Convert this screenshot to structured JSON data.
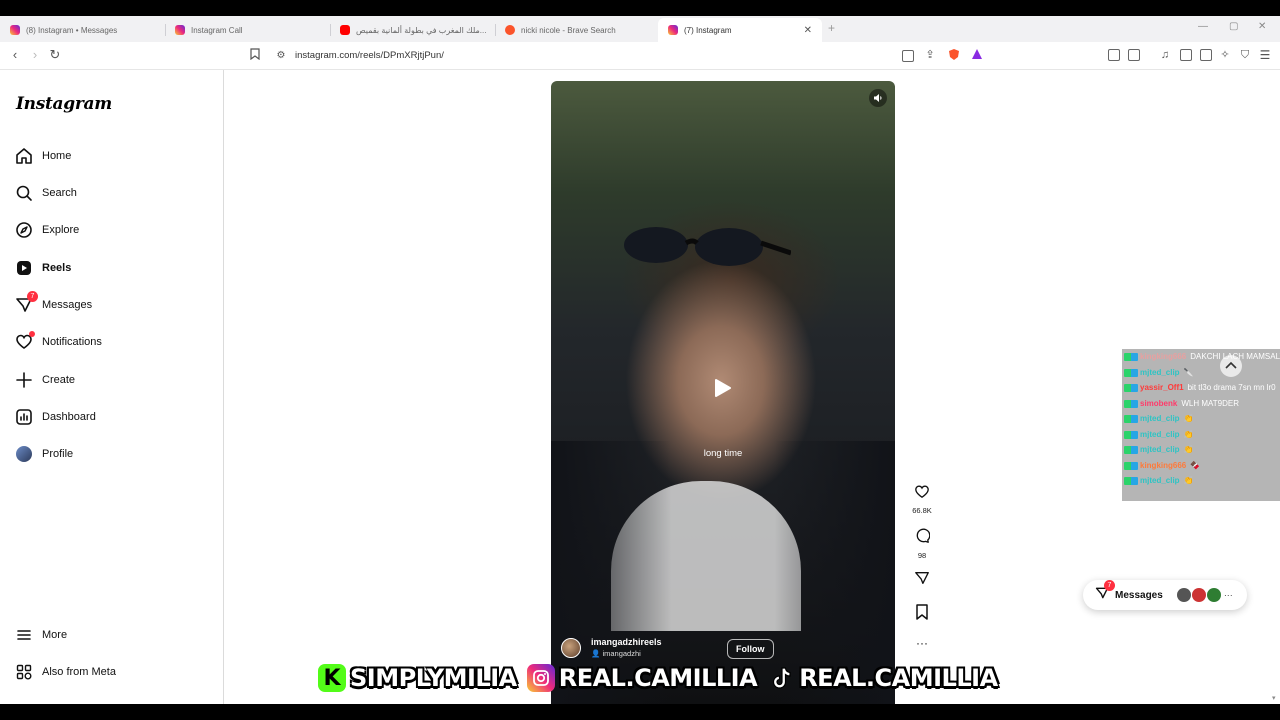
{
  "browser": {
    "tabs": [
      {
        "title": "(8) Instagram • Messages",
        "favicon": "instagram-icon",
        "active": false
      },
      {
        "title": "Instagram Call",
        "favicon": "instagram-icon",
        "active": false
      },
      {
        "title": "ملك المغرب في بطولة ألمانية بقميص...",
        "favicon": "youtube-icon",
        "active": false
      },
      {
        "title": "nicki nicole - Brave Search",
        "favicon": "brave-icon",
        "active": false
      },
      {
        "title": "(7) Instagram",
        "favicon": "instagram-icon",
        "active": true
      }
    ],
    "new_tab": "+",
    "url": "instagram.com/reels/DPmXRjtjPun/"
  },
  "sidebar": {
    "logo": "Instagram",
    "items": [
      {
        "label": "Home",
        "icon": "home-icon"
      },
      {
        "label": "Search",
        "icon": "search-icon"
      },
      {
        "label": "Explore",
        "icon": "compass-icon"
      },
      {
        "label": "Reels",
        "icon": "reels-icon"
      },
      {
        "label": "Messages",
        "icon": "messenger-icon",
        "badge": "7"
      },
      {
        "label": "Notifications",
        "icon": "heart-icon"
      },
      {
        "label": "Create",
        "icon": "plus-icon"
      },
      {
        "label": "Dashboard",
        "icon": "dashboard-icon"
      },
      {
        "label": "Profile",
        "icon": "avatar"
      }
    ],
    "more": "More",
    "also_meta": "Also from Meta"
  },
  "reel": {
    "caption": "long time",
    "author": "imangadzhireels",
    "author_sub": "imangadzhi",
    "follow": "Follow",
    "likes": "66.8K",
    "comments": "98"
  },
  "chat_overlay": {
    "rows": [
      {
        "user": "kingking666",
        "msg": "DAKCHI LACH MAMSALYCH",
        "color": "#e8a0a0"
      },
      {
        "user": "mjted_clip",
        "msg": "🔪",
        "color": "#2ec4c4"
      },
      {
        "user": "yassir_Off1",
        "msg": "bit tl3o drama 7sn mn lr0",
        "color": "#ff3a3a"
      },
      {
        "user": "simobenk",
        "msg": "WLH MAT9DER",
        "color": "#ff3a6a"
      },
      {
        "user": "mjted_clip",
        "msg": "👏",
        "color": "#2ec4c4"
      },
      {
        "user": "mjted_clip",
        "msg": "👏",
        "color": "#2ec4c4"
      },
      {
        "user": "mjted_clip",
        "msg": "👏",
        "color": "#2ec4c4"
      },
      {
        "user": "kingking666",
        "msg": "🍫",
        "color": "#ff7a3a"
      },
      {
        "user": "mjted_clip",
        "msg": "👏",
        "color": "#2ec4c4"
      }
    ]
  },
  "messages_pill": {
    "label": "Messages",
    "badge": "7"
  },
  "stream_banner": {
    "kick": "SIMPLYMILIA",
    "instagram": "REAL.CAMILLIA",
    "tiktok": "REAL.CAMILLIA"
  },
  "colors": {
    "accent": "#ff3040",
    "kick_green": "#53fc18"
  }
}
